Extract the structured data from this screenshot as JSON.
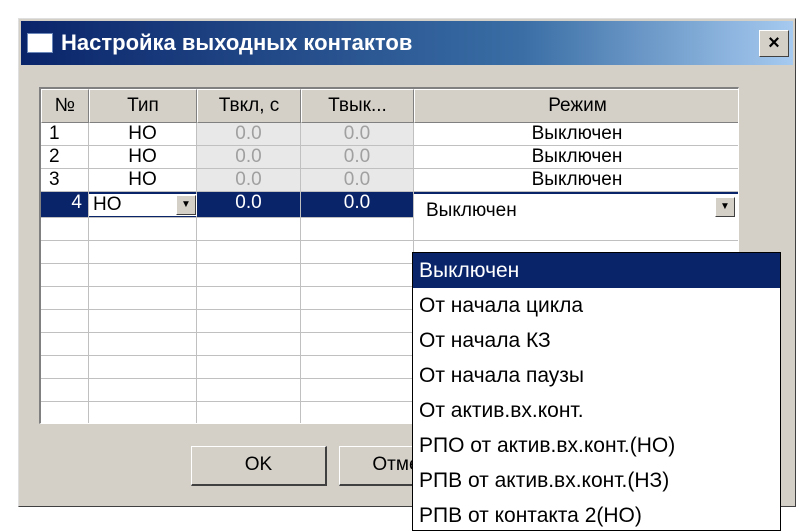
{
  "window": {
    "title": "Настройка выходных контактов",
    "close_label": "×"
  },
  "table": {
    "headers": [
      "№",
      "Тип",
      "Твкл, с",
      "Твык...",
      "Режим"
    ],
    "rows": [
      {
        "num": "1",
        "type": "НО",
        "ton": "0.0",
        "toff": "0.0",
        "mode": "Выключен"
      },
      {
        "num": "2",
        "type": "НО",
        "ton": "0.0",
        "toff": "0.0",
        "mode": "Выключен"
      },
      {
        "num": "3",
        "type": "НО",
        "ton": "0.0",
        "toff": "0.0",
        "mode": "Выключен"
      },
      {
        "num": "4",
        "type": "НО",
        "ton": "0.0",
        "toff": "0.0",
        "mode": "Выключен"
      }
    ],
    "selected_row": 4
  },
  "mode_options": [
    "Выключен",
    "От начала цикла",
    "От начала КЗ",
    "От начала паузы",
    "От актив.вх.конт.",
    "РПО от актив.вх.конт.(НО)",
    "РПВ от актив.вх.конт.(НЗ)",
    "РПВ от контакта 2(НО)"
  ],
  "buttons": {
    "ok": "OK",
    "cancel": "Отмена"
  },
  "icons": {
    "combo_arrow": "▼"
  },
  "colors": {
    "selection": "#0a246a",
    "dialog_bg": "#d4d0c8"
  }
}
